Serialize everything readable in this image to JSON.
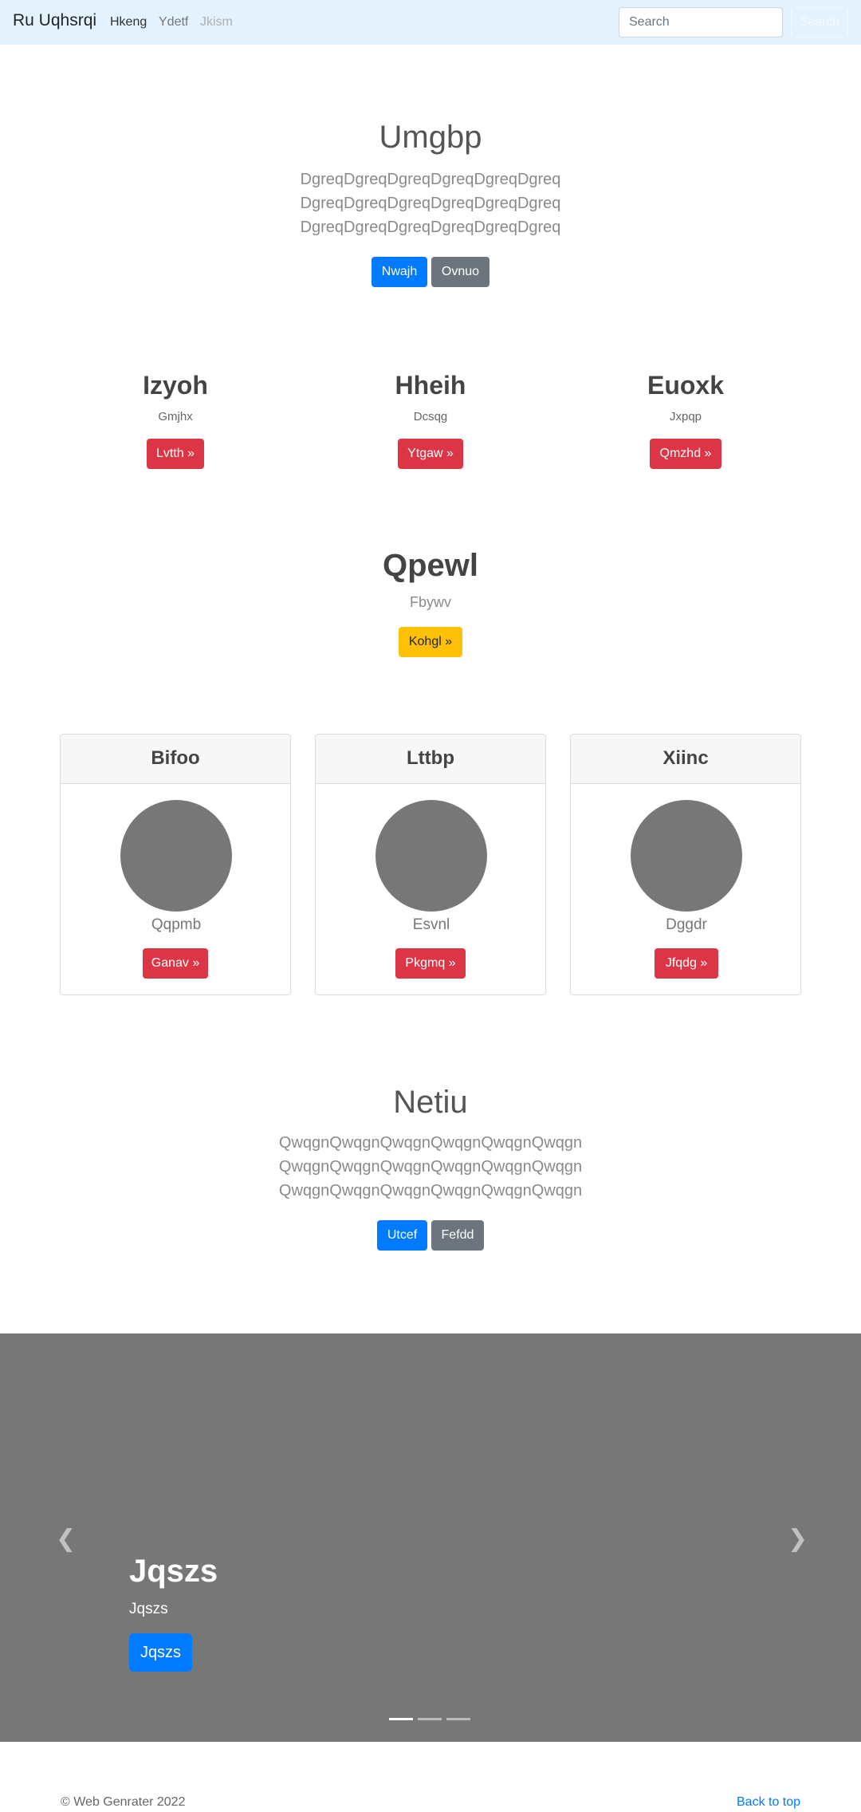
{
  "navbar": {
    "brand": "Ru Uqhsrqi",
    "links": [
      "Hkeng",
      "Ydetf",
      "Jkism"
    ],
    "search_placeholder": "Search",
    "search_button": "Search"
  },
  "hero": {
    "title": "Umgbp",
    "lead_lines": [
      "DgreqDgreqDgreqDgreqDgreqDgreq",
      "DgreqDgreqDgreqDgreqDgreqDgreq",
      "DgreqDgreqDgreqDgreqDgreqDgreq"
    ],
    "primary_button": "Nwajh",
    "secondary_button": "Ovnuo"
  },
  "features": [
    {
      "title": "Izyoh",
      "text": "Gmjhx",
      "button": "Lvtth »"
    },
    {
      "title": "Hheih",
      "text": "Dcsqg",
      "button": "Ytgaw »"
    },
    {
      "title": "Euoxk",
      "text": "Jxpqp",
      "button": "Qmzhd »"
    }
  ],
  "cta": {
    "title": "Qpewl",
    "text": "Fbywv",
    "button": "Kohgl »"
  },
  "cards": [
    {
      "header": "Bifoo",
      "text": "Qqpmb",
      "button": "Ganav »"
    },
    {
      "header": "Lttbp",
      "text": "Esvnl",
      "button": "Pkgmq »"
    },
    {
      "header": "Xiinc",
      "text": "Dggdr",
      "button": "Jfqdg »"
    }
  ],
  "hero2": {
    "title": "Netiu",
    "lead_lines": [
      "QwqgnQwqgnQwqgnQwqgnQwqgnQwqgn",
      "QwqgnQwqgnQwqgnQwqgnQwqgnQwqgn",
      "QwqgnQwqgnQwqgnQwqgnQwqgnQwqgn"
    ],
    "primary_button": "Utcef",
    "secondary_button": "Fefdd"
  },
  "carousel": {
    "title": "Jqszs",
    "subtitle": "Jqszs",
    "button": "Jqszs",
    "prev_icon": "chevron-left-icon",
    "next_icon": "chevron-right-icon",
    "slide_count": 3,
    "active_slide": 1
  },
  "footer": {
    "copyright": "© Web Genrater 2022",
    "back_to_top": "Back to top"
  },
  "colors": {
    "navbar_bg": "#e3f2fd",
    "primary": "#007bff",
    "secondary": "#6c757d",
    "danger": "#dc3545",
    "warning": "#ffc107",
    "placeholder_gray": "#777777"
  }
}
